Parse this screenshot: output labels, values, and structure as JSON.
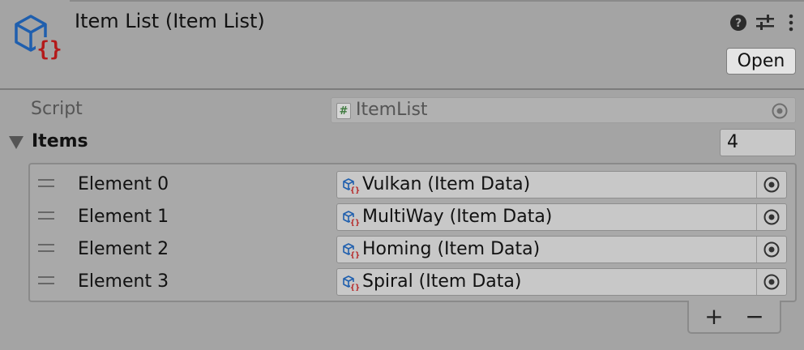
{
  "header": {
    "title": "Item List (Item List)",
    "open_label": "Open",
    "icons": [
      "asset-icon",
      "help-icon",
      "preset-icon",
      "kebab-menu-icon"
    ]
  },
  "script_row": {
    "label": "Script",
    "value": "ItemList",
    "icon_text": "#"
  },
  "items": {
    "label": "Items",
    "count": "4",
    "elements": [
      {
        "label": "Element 0",
        "value": "Vulkan (Item Data)"
      },
      {
        "label": "Element 1",
        "value": "MultiWay (Item Data)"
      },
      {
        "label": "Element 2",
        "value": "Homing (Item Data)"
      },
      {
        "label": "Element 3",
        "value": "Spiral (Item Data)"
      }
    ]
  },
  "footer": {
    "add_label": "+",
    "remove_label": "−"
  },
  "colors": {
    "background": "#a4a4a4",
    "field": "#c8c8c8",
    "icon_blue": "#1f5fae",
    "icon_red": "#b41a1a"
  }
}
